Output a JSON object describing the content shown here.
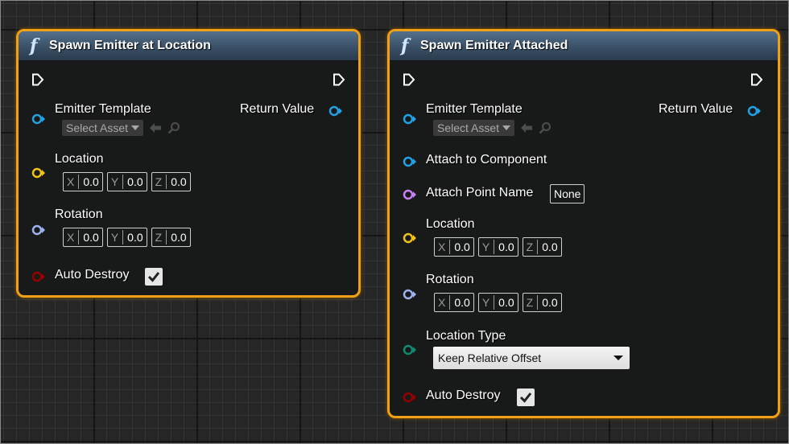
{
  "colors": {
    "node_border": "#f0a017",
    "exec": "#ffffff",
    "object_pin": "#21a2e6",
    "vector_pin": "#f2c21b",
    "rotator_pin": "#9db2f0",
    "bool_pin": "#950000",
    "name_pin": "#c980f2",
    "byte_pin": "#108a72"
  },
  "node1": {
    "title": "Spawn Emitter at Location",
    "emitter_template": {
      "label": "Emitter Template",
      "select_asset": "Select Asset"
    },
    "return_value": "Return Value",
    "location": {
      "label": "Location",
      "x": "0.0",
      "y": "0.0",
      "z": "0.0"
    },
    "rotation": {
      "label": "Rotation",
      "x": "0.0",
      "y": "0.0",
      "z": "0.0"
    },
    "auto_destroy": {
      "label": "Auto Destroy",
      "checked": true
    }
  },
  "node2": {
    "title": "Spawn Emitter Attached",
    "emitter_template": {
      "label": "Emitter Template",
      "select_asset": "Select Asset"
    },
    "return_value": "Return Value",
    "attach_to_component": "Attach to Component",
    "attach_point_name": {
      "label": "Attach Point Name",
      "value": "None"
    },
    "location": {
      "label": "Location",
      "x": "0.0",
      "y": "0.0",
      "z": "0.0"
    },
    "rotation": {
      "label": "Rotation",
      "x": "0.0",
      "y": "0.0",
      "z": "0.0"
    },
    "location_type": {
      "label": "Location Type",
      "value": "Keep Relative Offset"
    },
    "auto_destroy": {
      "label": "Auto Destroy",
      "checked": true
    }
  },
  "axes": {
    "x": "X",
    "y": "Y",
    "z": "Z"
  }
}
